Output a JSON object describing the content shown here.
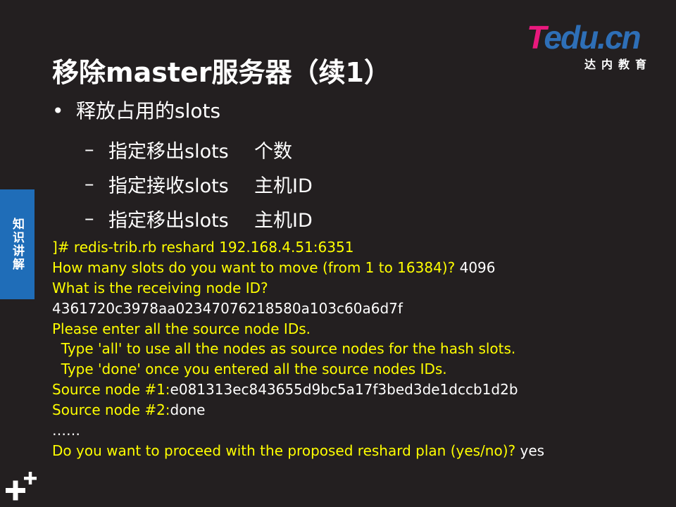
{
  "logo": {
    "brand_t": "T",
    "brand_rest": "edu.cn",
    "subtitle": "达内教育",
    "colors": {
      "t": "#e8197d",
      "rest": "#2e6fb7"
    }
  },
  "title": "移除master服务器（续1）",
  "bullet": {
    "symbol": "•",
    "text": "释放占用的slots",
    "sub_items": [
      {
        "dash": "–",
        "label": "指定移出slots",
        "value": "个数"
      },
      {
        "dash": "–",
        "label": "指定接收slots",
        "value": "主机ID"
      },
      {
        "dash": "–",
        "label": "指定移出slots",
        "value": "主机ID"
      }
    ]
  },
  "side_tab": {
    "label": "知识讲解",
    "color": "#1f6db8"
  },
  "terminal": {
    "colors": {
      "prompt": "#ffff00",
      "input": "#ffffff"
    },
    "lines": [
      {
        "prompt": "]# redis-trib.rb reshard 192.168.4.51:6351",
        "input": ""
      },
      {
        "prompt": "How many slots do you want to move (from 1 to 16384)? ",
        "input": "4096"
      },
      {
        "prompt": "What is the receiving node ID?",
        "input": ""
      },
      {
        "prompt": "",
        "input": "4361720c3978aa02347076218580a103c60a6d7f"
      },
      {
        "prompt": "Please enter all the source node IDs.",
        "input": ""
      },
      {
        "prompt": "  Type 'all' to use all the nodes as source nodes for the hash slots.",
        "input": ""
      },
      {
        "prompt": "  Type 'done' once you entered all the source nodes IDs.",
        "input": ""
      },
      {
        "prompt": "Source node #1:",
        "input": "e081313ec843655d9bc5a17f3bed3de1dccb1d2b"
      },
      {
        "prompt": "Source node #2:",
        "input": "done"
      },
      {
        "prompt": "",
        "input": "……"
      },
      {
        "prompt": "Do you want to proceed with the proposed reshard plan (yes/no)? ",
        "input": "yes"
      }
    ]
  },
  "decoration": {
    "corner_icon": "plus-icon"
  }
}
